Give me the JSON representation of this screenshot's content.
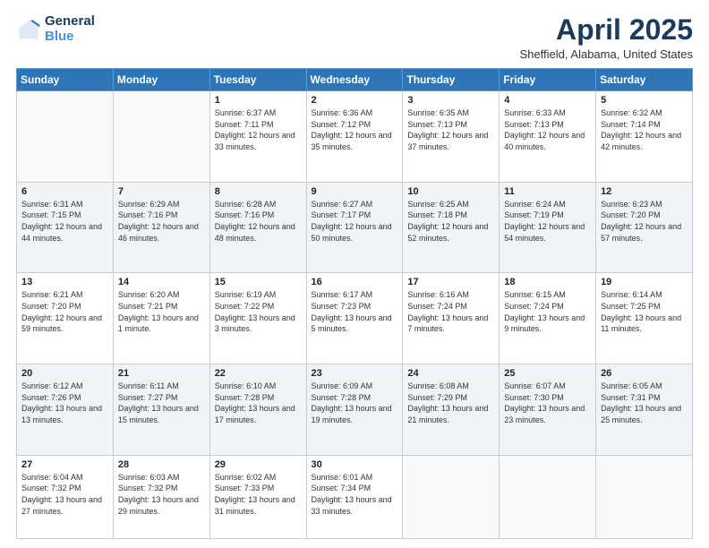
{
  "logo": {
    "line1": "General",
    "line2": "Blue",
    "icon_color": "#4a90d9"
  },
  "title": {
    "month_year": "April 2025",
    "location": "Sheffield, Alabama, United States"
  },
  "weekdays": [
    "Sunday",
    "Monday",
    "Tuesday",
    "Wednesday",
    "Thursday",
    "Friday",
    "Saturday"
  ],
  "weeks": [
    [
      {
        "day": "",
        "info": ""
      },
      {
        "day": "",
        "info": ""
      },
      {
        "day": "1",
        "info": "Sunrise: 6:37 AM\nSunset: 7:11 PM\nDaylight: 12 hours and 33 minutes."
      },
      {
        "day": "2",
        "info": "Sunrise: 6:36 AM\nSunset: 7:12 PM\nDaylight: 12 hours and 35 minutes."
      },
      {
        "day": "3",
        "info": "Sunrise: 6:35 AM\nSunset: 7:13 PM\nDaylight: 12 hours and 37 minutes."
      },
      {
        "day": "4",
        "info": "Sunrise: 6:33 AM\nSunset: 7:13 PM\nDaylight: 12 hours and 40 minutes."
      },
      {
        "day": "5",
        "info": "Sunrise: 6:32 AM\nSunset: 7:14 PM\nDaylight: 12 hours and 42 minutes."
      }
    ],
    [
      {
        "day": "6",
        "info": "Sunrise: 6:31 AM\nSunset: 7:15 PM\nDaylight: 12 hours and 44 minutes."
      },
      {
        "day": "7",
        "info": "Sunrise: 6:29 AM\nSunset: 7:16 PM\nDaylight: 12 hours and 46 minutes."
      },
      {
        "day": "8",
        "info": "Sunrise: 6:28 AM\nSunset: 7:16 PM\nDaylight: 12 hours and 48 minutes."
      },
      {
        "day": "9",
        "info": "Sunrise: 6:27 AM\nSunset: 7:17 PM\nDaylight: 12 hours and 50 minutes."
      },
      {
        "day": "10",
        "info": "Sunrise: 6:25 AM\nSunset: 7:18 PM\nDaylight: 12 hours and 52 minutes."
      },
      {
        "day": "11",
        "info": "Sunrise: 6:24 AM\nSunset: 7:19 PM\nDaylight: 12 hours and 54 minutes."
      },
      {
        "day": "12",
        "info": "Sunrise: 6:23 AM\nSunset: 7:20 PM\nDaylight: 12 hours and 57 minutes."
      }
    ],
    [
      {
        "day": "13",
        "info": "Sunrise: 6:21 AM\nSunset: 7:20 PM\nDaylight: 12 hours and 59 minutes."
      },
      {
        "day": "14",
        "info": "Sunrise: 6:20 AM\nSunset: 7:21 PM\nDaylight: 13 hours and 1 minute."
      },
      {
        "day": "15",
        "info": "Sunrise: 6:19 AM\nSunset: 7:22 PM\nDaylight: 13 hours and 3 minutes."
      },
      {
        "day": "16",
        "info": "Sunrise: 6:17 AM\nSunset: 7:23 PM\nDaylight: 13 hours and 5 minutes."
      },
      {
        "day": "17",
        "info": "Sunrise: 6:16 AM\nSunset: 7:24 PM\nDaylight: 13 hours and 7 minutes."
      },
      {
        "day": "18",
        "info": "Sunrise: 6:15 AM\nSunset: 7:24 PM\nDaylight: 13 hours and 9 minutes."
      },
      {
        "day": "19",
        "info": "Sunrise: 6:14 AM\nSunset: 7:25 PM\nDaylight: 13 hours and 11 minutes."
      }
    ],
    [
      {
        "day": "20",
        "info": "Sunrise: 6:12 AM\nSunset: 7:26 PM\nDaylight: 13 hours and 13 minutes."
      },
      {
        "day": "21",
        "info": "Sunrise: 6:11 AM\nSunset: 7:27 PM\nDaylight: 13 hours and 15 minutes."
      },
      {
        "day": "22",
        "info": "Sunrise: 6:10 AM\nSunset: 7:28 PM\nDaylight: 13 hours and 17 minutes."
      },
      {
        "day": "23",
        "info": "Sunrise: 6:09 AM\nSunset: 7:28 PM\nDaylight: 13 hours and 19 minutes."
      },
      {
        "day": "24",
        "info": "Sunrise: 6:08 AM\nSunset: 7:29 PM\nDaylight: 13 hours and 21 minutes."
      },
      {
        "day": "25",
        "info": "Sunrise: 6:07 AM\nSunset: 7:30 PM\nDaylight: 13 hours and 23 minutes."
      },
      {
        "day": "26",
        "info": "Sunrise: 6:05 AM\nSunset: 7:31 PM\nDaylight: 13 hours and 25 minutes."
      }
    ],
    [
      {
        "day": "27",
        "info": "Sunrise: 6:04 AM\nSunset: 7:32 PM\nDaylight: 13 hours and 27 minutes."
      },
      {
        "day": "28",
        "info": "Sunrise: 6:03 AM\nSunset: 7:32 PM\nDaylight: 13 hours and 29 minutes."
      },
      {
        "day": "29",
        "info": "Sunrise: 6:02 AM\nSunset: 7:33 PM\nDaylight: 13 hours and 31 minutes."
      },
      {
        "day": "30",
        "info": "Sunrise: 6:01 AM\nSunset: 7:34 PM\nDaylight: 13 hours and 33 minutes."
      },
      {
        "day": "",
        "info": ""
      },
      {
        "day": "",
        "info": ""
      },
      {
        "day": "",
        "info": ""
      }
    ]
  ]
}
